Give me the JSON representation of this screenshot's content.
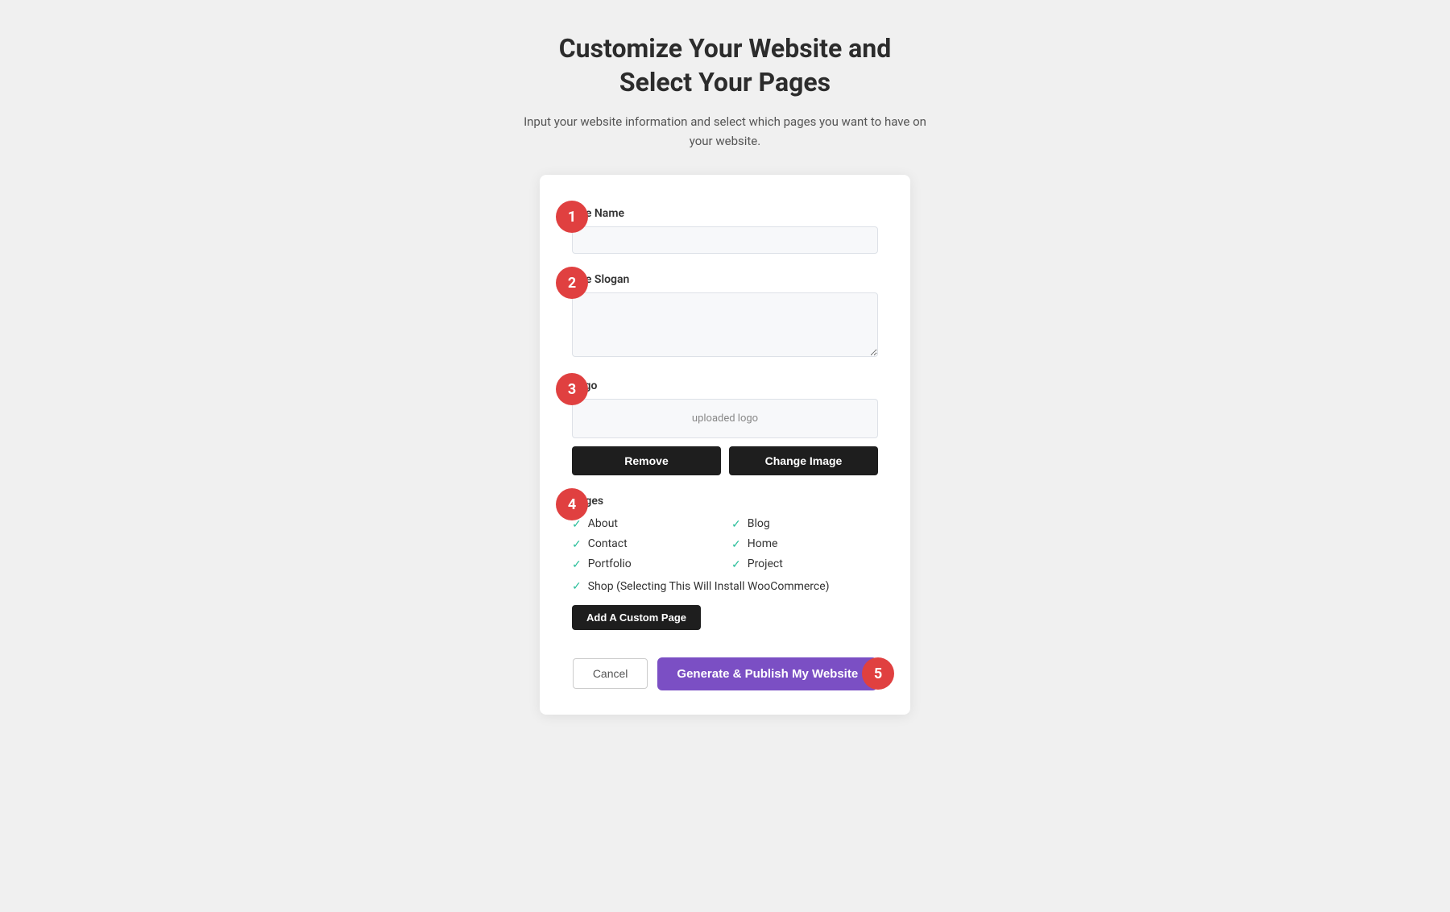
{
  "header": {
    "title_line1": "Customize Your Website and",
    "title_line2": "Select Your Pages",
    "subtitle": "Input your website information and select which pages you want to have on your website."
  },
  "form": {
    "site_name_label": "Site Name",
    "site_name_value": "",
    "site_slogan_label": "Site Slogan",
    "site_slogan_value": "",
    "logo_label": "Logo",
    "logo_placeholder_text": "uploaded logo",
    "remove_button": "Remove",
    "change_image_button": "Change Image",
    "pages_label": "Pages",
    "pages": [
      {
        "name": "About",
        "checked": true
      },
      {
        "name": "Blog",
        "checked": true
      },
      {
        "name": "Contact",
        "checked": true
      },
      {
        "name": "Home",
        "checked": true
      },
      {
        "name": "Portfolio",
        "checked": true
      },
      {
        "name": "Project",
        "checked": true
      }
    ],
    "shop_page": {
      "name": "Shop (Selecting This Will Install WooCommerce)",
      "checked": true
    },
    "add_custom_page_button": "Add A Custom Page",
    "cancel_button": "Cancel",
    "publish_button": "Generate & Publish My Website"
  },
  "steps": {
    "step1": "1",
    "step2": "2",
    "step3": "3",
    "step4": "4",
    "step5": "5"
  },
  "colors": {
    "step_badge": "#e04040",
    "publish_button": "#7b4fc4",
    "check": "#2bbf9b"
  }
}
